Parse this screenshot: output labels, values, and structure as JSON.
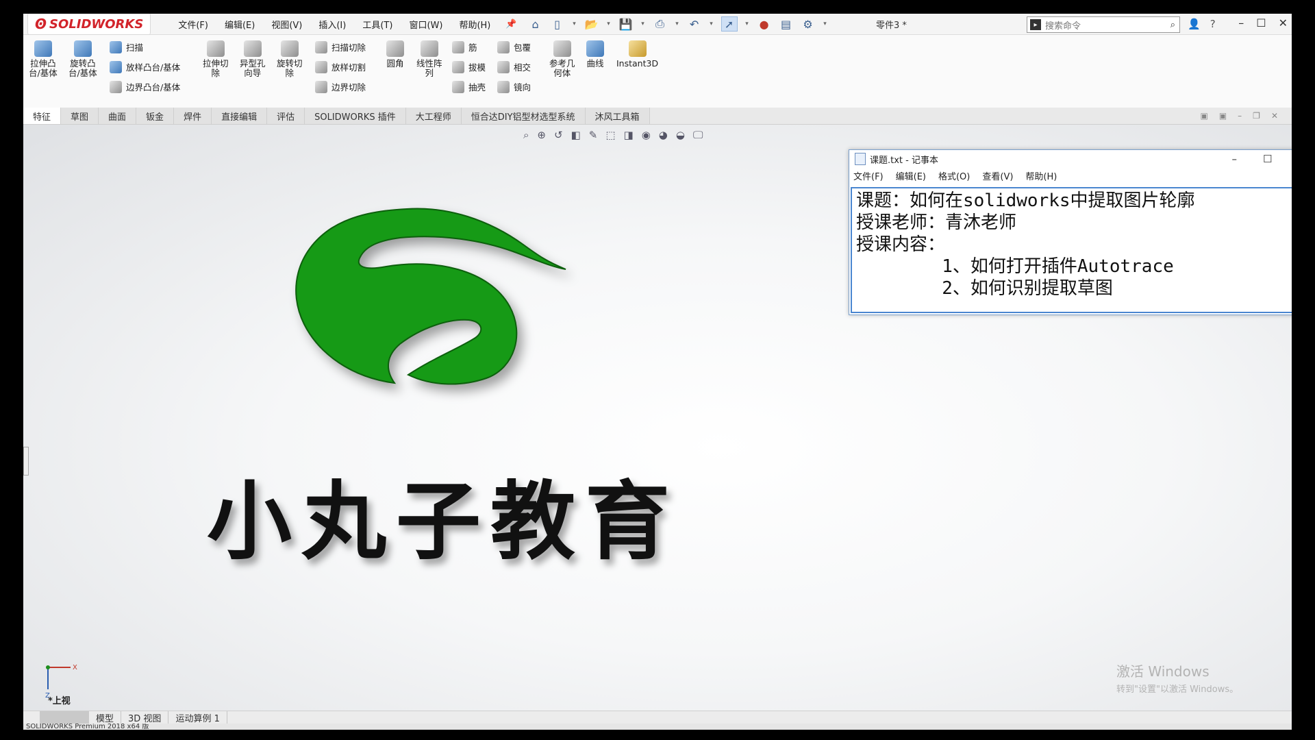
{
  "app": {
    "brand": "SOLIDWORKS",
    "doc_title": "零件3 *",
    "search_placeholder": "搜索命令"
  },
  "menu": [
    "文件(F)",
    "编辑(E)",
    "视图(V)",
    "插入(I)",
    "工具(T)",
    "窗口(W)",
    "帮助(H)"
  ],
  "ribbon": {
    "extrude_boss": "拉伸凸\n台/基体",
    "revolve_boss": "旋转凸\n台/基体",
    "sweep": "扫描",
    "loft_boss": "放样凸台/基体",
    "boundary_boss": "边界凸台/基体",
    "extrude_cut": "拉伸切\n除",
    "hole_wizard": "异型孔\n向导",
    "revolve_cut": "旋转切\n除",
    "sweep_cut": "扫描切除",
    "loft_cut": "放样切割",
    "boundary_cut": "边界切除",
    "fillet": "圆角",
    "linear_pattern": "线性阵\n列",
    "rib": "筋",
    "draft": "拔模",
    "shell": "抽壳",
    "wrap": "包覆",
    "intersect": "相交",
    "mirror": "镜向",
    "ref_geometry": "参考几\n何体",
    "curves": "曲线",
    "instant3d": "Instant3D"
  },
  "tabs": [
    "特征",
    "草图",
    "曲面",
    "钣金",
    "焊件",
    "直接编辑",
    "评估",
    "SOLIDWORKS 插件",
    "大工程师",
    "恒合达DIY铝型材选型系统",
    "沐风工具箱"
  ],
  "graphics": {
    "brand_text": "小丸子教育",
    "view_label": "*上视"
  },
  "notepad": {
    "title": "课题.txt - 记事本",
    "menu": [
      "文件(F)",
      "编辑(E)",
      "格式(O)",
      "查看(V)",
      "帮助(H)"
    ],
    "lines": [
      "课题：如何在solidworks中提取图片轮廓",
      "授课老师：青沐老师",
      "授课内容：",
      "        1、如何打开插件Autotrace",
      "        2、如何识别提取草图"
    ]
  },
  "bottom_tabs": [
    "模型",
    "3D 视图",
    "运动算例 1"
  ],
  "status": "SOLIDWORKS Premium 2018 x64 版",
  "watermark": {
    "line1": "激活 Windows",
    "line2": "转到\"设置\"以激活 Windows。"
  },
  "colors": {
    "logo_green": "#159a14",
    "brand_red": "#d2232a"
  }
}
